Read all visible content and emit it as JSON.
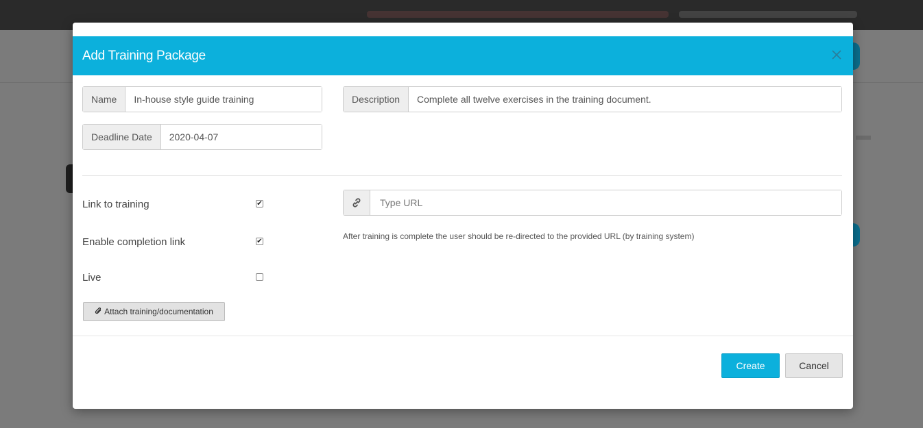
{
  "modal": {
    "title": "Add Training Package",
    "close_icon": "close-icon"
  },
  "form": {
    "name_label": "Name",
    "name_value": "In-house style guide training",
    "deadline_label": "Deadline Date",
    "deadline_value": "2020-04-07",
    "description_label": "Description",
    "description_value": "Complete all twelve exercises in the training document.",
    "link_to_training_label": "Link to training",
    "link_to_training_checked": true,
    "enable_completion_label": "Enable completion link",
    "enable_completion_checked": true,
    "live_label": "Live",
    "live_checked": false,
    "url_icon": "link-icon",
    "url_placeholder": "Type URL",
    "url_helper": "After training is complete the user should be re-directed to the provided URL (by training system)",
    "attach_icon": "paperclip-icon",
    "attach_label": "Attach training/documentation"
  },
  "footer": {
    "create_label": "Create",
    "cancel_label": "Cancel"
  },
  "colors": {
    "accent": "#0cb0dc"
  }
}
